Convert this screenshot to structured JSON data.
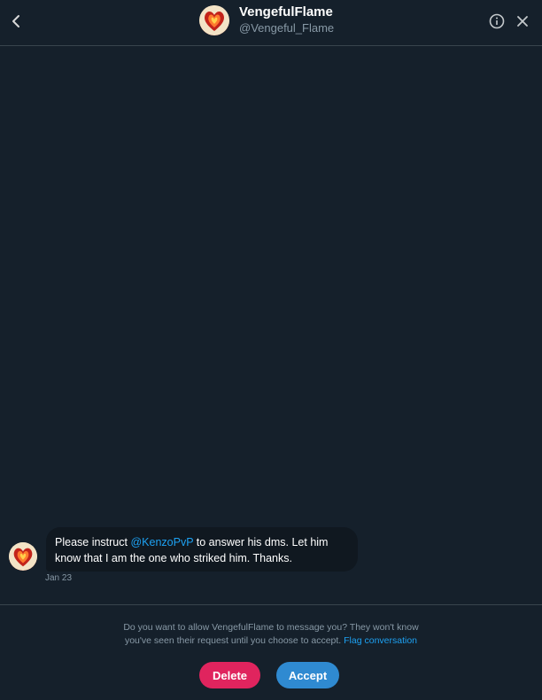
{
  "header": {
    "display_name": "VengefulFlame",
    "handle": "@Vengeful_Flame",
    "icons": {
      "back": "chevron-left-icon",
      "info": "info-icon",
      "close": "close-icon"
    }
  },
  "conversation": {
    "messages": [
      {
        "text_before": "Please instruct ",
        "mention": "@KenzoPvP",
        "text_line1_after": " to answer his dms. Let him",
        "text_line2": "know that I am the one who striked him. Thanks.",
        "date": "Jan 23"
      }
    ]
  },
  "request": {
    "prompt_line1": "Do you want to allow VengefulFlame to message you? They won't know",
    "prompt_line2": "you've seen their request until you choose to accept.",
    "flag_label": "Flag conversation",
    "delete_label": "Delete",
    "accept_label": "Accept"
  },
  "colors": {
    "background": "#15202b",
    "accent": "#1da1f2",
    "delete": "#e0245e",
    "accept": "#2f8ad1"
  }
}
